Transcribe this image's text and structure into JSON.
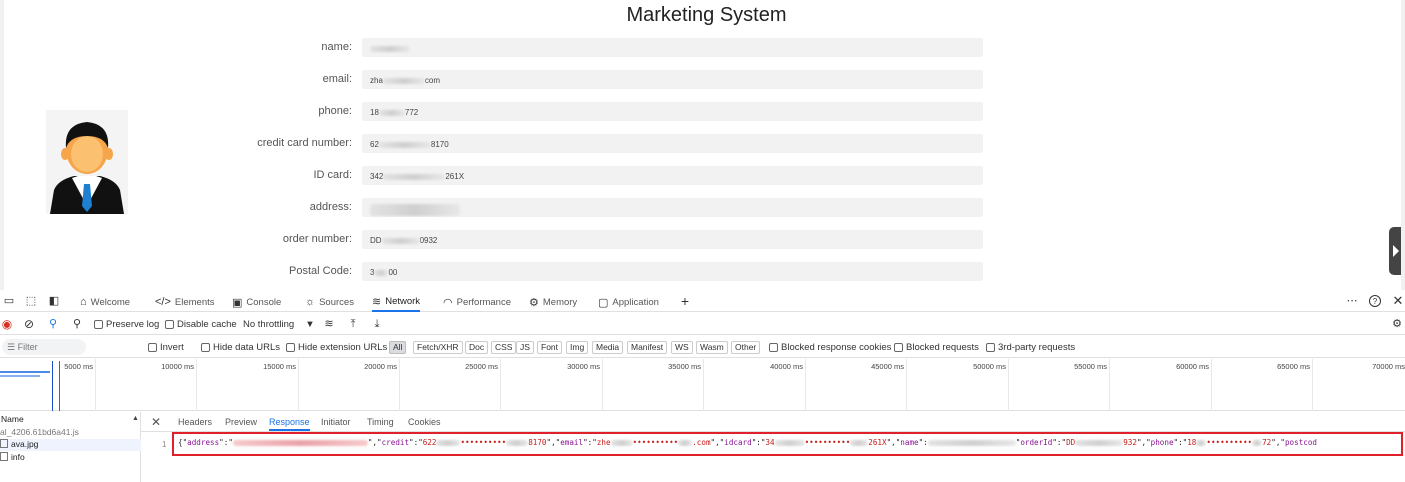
{
  "page": {
    "title": "Marketing System",
    "fields": [
      {
        "label": "name:",
        "value": ""
      },
      {
        "label": "email:",
        "value": "zha",
        "value_end": "com"
      },
      {
        "label": "phone:",
        "value": "18",
        "value_end": "772"
      },
      {
        "label": "credit card number:",
        "value": "62",
        "value_end": "8170"
      },
      {
        "label": "ID card:",
        "value": "342",
        "value_end": "261X"
      },
      {
        "label": "address:",
        "value": ""
      },
      {
        "label": "order number:",
        "value": "DD",
        "value_end": "0932"
      },
      {
        "label": "Postal Code:",
        "value": "3",
        "value_end": "00"
      }
    ]
  },
  "devtools": {
    "tabs": [
      {
        "label": "Welcome",
        "icon": "home-icon"
      },
      {
        "label": "Elements",
        "icon": "code-icon"
      },
      {
        "label": "Console",
        "icon": "console-icon"
      },
      {
        "label": "Sources",
        "icon": "sources-icon"
      },
      {
        "label": "Network",
        "icon": "wifi-icon",
        "active": true
      },
      {
        "label": "Performance",
        "icon": "performance-icon"
      },
      {
        "label": "Memory",
        "icon": "memory-icon"
      },
      {
        "label": "Application",
        "icon": "application-icon"
      }
    ],
    "toolbar": {
      "preserve_log": "Preserve log",
      "disable_cache": "Disable cache",
      "throttling": "No throttling"
    },
    "filter": {
      "placeholder": "Filter",
      "invert": "Invert",
      "hide_data_urls": "Hide data URLs",
      "hide_extension_urls": "Hide extension URLs",
      "types": [
        "All",
        "Fetch/XHR",
        "Doc",
        "CSS",
        "JS",
        "Font",
        "Img",
        "Media",
        "Manifest",
        "WS",
        "Wasm",
        "Other"
      ],
      "active_type": "All",
      "blocked_response_cookies": "Blocked response cookies",
      "blocked_requests": "Blocked requests",
      "third_party": "3rd-party requests"
    },
    "timeline_ticks": [
      "5000 ms",
      "10000 ms",
      "15000 ms",
      "20000 ms",
      "25000 ms",
      "30000 ms",
      "35000 ms",
      "40000 ms",
      "45000 ms",
      "50000 ms",
      "55000 ms",
      "60000 ms",
      "65000 ms",
      "70000 ms"
    ],
    "requests": {
      "header": "Name",
      "items": [
        "al_4206.61bd6a41.js",
        "ava.jpg",
        "info"
      ]
    },
    "detail_tabs": [
      "Headers",
      "Preview",
      "Response",
      "Initiator",
      "Timing",
      "Cookies"
    ],
    "active_detail_tab": "Response",
    "response": {
      "line_number": "1",
      "address_key": "address",
      "credit_key": "credit",
      "credit_value_start": "622",
      "credit_value_end": "8170",
      "email_key": "email",
      "email_value_start": "zhe",
      "email_value_end": ".com",
      "idcard_key": "idcard",
      "idcard_value_start": "34",
      "idcard_value_end": "261X",
      "name_key": "name",
      "order_key": "orderId",
      "order_value_start": "DD",
      "order_value_end": "932",
      "phone_key": "phone",
      "phone_value_start": "18",
      "phone_value_end": "72",
      "postcode_key": "postcod",
      "mask": "••••••••••"
    },
    "colors": {
      "accent": "#1a73e8",
      "highlight_border": "#e0202a",
      "json_key": "#881391",
      "json_string": "#c41a16"
    }
  }
}
